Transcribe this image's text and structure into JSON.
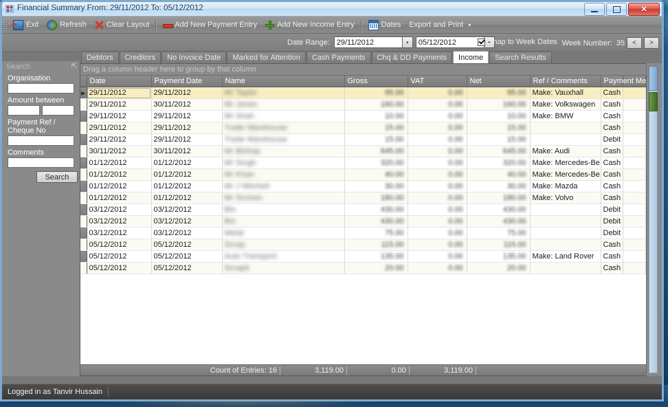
{
  "window": {
    "title": "Financial Summary From: 29/11/2012 To: 05/12/2012",
    "icon": "app-icon",
    "minimize": "—",
    "maximize": "▢",
    "close": "✕"
  },
  "toolbar": {
    "items": [
      {
        "label": "Exit",
        "icon": "exit-icon"
      },
      {
        "label": "Refresh",
        "icon": "refresh-icon"
      },
      {
        "label": "Clear Layout",
        "icon": "red-x-icon"
      },
      {
        "label": "Add New Payment Entry",
        "icon": "red-minus-icon"
      },
      {
        "label": "Add New Income Entry",
        "icon": "green-plus-icon"
      },
      {
        "label": "Dates",
        "icon": "calendar-icon"
      },
      {
        "label": "Export and Print",
        "icon": "none",
        "caret": "▾"
      }
    ]
  },
  "filterbar": {
    "date_range_label": "Date Range:",
    "date_from": "29/11/2012",
    "date_to": "05/12/2012",
    "dropdown_glyph": "▾",
    "snap_label": "Snap to Week Dates",
    "snap_checked": true,
    "week_label": "Week Number:",
    "week_number": "35",
    "prev_glyph": "<",
    "next_glyph": ">"
  },
  "sidebar": {
    "title": "Search",
    "pin_glyph": "⇱",
    "fields": [
      {
        "label": "Organisation",
        "value": "",
        "type": "text"
      },
      {
        "label": "Amount between",
        "value": "",
        "value2": "",
        "type": "range"
      },
      {
        "label": "Payment Ref / Cheque No",
        "value": "",
        "type": "text"
      },
      {
        "label": "Comments",
        "value": "",
        "type": "text"
      }
    ],
    "search_button": "Search"
  },
  "tabs": [
    {
      "label": "Debtors",
      "active": false
    },
    {
      "label": "Creditors",
      "active": false
    },
    {
      "label": "No Invoice Date",
      "active": false
    },
    {
      "label": "Marked for Attention",
      "active": false
    },
    {
      "label": "Cash Payments",
      "active": false
    },
    {
      "label": "Chq & DD Payments",
      "active": false
    },
    {
      "label": "Income",
      "active": true
    },
    {
      "label": "Search Results",
      "active": false
    }
  ],
  "grid": {
    "group_hint": "Drag a column header here to group by that column",
    "columns": [
      "Date",
      "Payment Date",
      "Name",
      "Gross",
      "VAT",
      "Net",
      "Ref / Comments",
      "Payment Method"
    ],
    "row_indicator_glyph": "▶",
    "rows": [
      {
        "date": "29/11/2012",
        "payment_date": "29/11/2012",
        "name": "Mr Taylor",
        "gross": "95.00",
        "vat": "0.00",
        "net": "95.00",
        "ref": "Make: Vauxhall",
        "method": "Cash",
        "selected": true
      },
      {
        "date": "29/11/2012",
        "payment_date": "30/11/2012",
        "name": "Mr Jones",
        "gross": "160.00",
        "vat": "0.00",
        "net": "160.00",
        "ref": "Make: Volkswagen",
        "method": "Cash",
        "selected": false
      },
      {
        "date": "29/11/2012",
        "payment_date": "29/11/2012",
        "name": "Mr Shah",
        "gross": "10.00",
        "vat": "0.00",
        "net": "10.00",
        "ref": "Make: BMW",
        "method": "Cash",
        "selected": false
      },
      {
        "date": "29/11/2012",
        "payment_date": "29/11/2012",
        "name": "Trade Warehouse",
        "gross": "15.00",
        "vat": "0.00",
        "net": "15.00",
        "ref": "",
        "method": "Cash",
        "selected": false
      },
      {
        "date": "29/11/2012",
        "payment_date": "29/11/2012",
        "name": "Trade Warehouse",
        "gross": "15.00",
        "vat": "0.00",
        "net": "15.00",
        "ref": "",
        "method": "Debit Card",
        "selected": false
      },
      {
        "date": "30/11/2012",
        "payment_date": "30/11/2012",
        "name": "Mr Bishop",
        "gross": "645.00",
        "vat": "0.00",
        "net": "645.00",
        "ref": "Make: Audi",
        "method": "Cash",
        "selected": false
      },
      {
        "date": "01/12/2012",
        "payment_date": "01/12/2012",
        "name": "Mr Singh",
        "gross": "320.00",
        "vat": "0.00",
        "net": "320.00",
        "ref": "Make: Mercedes-Be",
        "method": "Cash",
        "selected": false
      },
      {
        "date": "01/12/2012",
        "payment_date": "01/12/2012",
        "name": "Mr Khan",
        "gross": "40.00",
        "vat": "0.00",
        "net": "40.00",
        "ref": "Make: Mercedes-Be",
        "method": "Cash",
        "selected": false
      },
      {
        "date": "01/12/2012",
        "payment_date": "01/12/2012",
        "name": "Mr J Mitchell",
        "gross": "30.00",
        "vat": "0.00",
        "net": "30.00",
        "ref": "Make: Mazda",
        "method": "Cash",
        "selected": false
      },
      {
        "date": "01/12/2012",
        "payment_date": "01/12/2012",
        "name": "Mr Scriven",
        "gross": "180.00",
        "vat": "0.00",
        "net": "180.00",
        "ref": "Make: Volvo",
        "method": "Cash",
        "selected": false
      },
      {
        "date": "03/12/2012",
        "payment_date": "03/12/2012",
        "name": "Bin",
        "gross": "430.00",
        "vat": "0.00",
        "net": "430.00",
        "ref": "",
        "method": "Debit Card",
        "selected": false
      },
      {
        "date": "03/12/2012",
        "payment_date": "03/12/2012",
        "name": "Bin",
        "gross": "430.00",
        "vat": "0.00",
        "net": "430.00",
        "ref": "",
        "method": "Debit Card",
        "selected": false
      },
      {
        "date": "03/12/2012",
        "payment_date": "03/12/2012",
        "name": "Metal",
        "gross": "75.00",
        "vat": "0.00",
        "net": "75.00",
        "ref": "",
        "method": "Debit Card",
        "selected": false
      },
      {
        "date": "05/12/2012",
        "payment_date": "05/12/2012",
        "name": "Scrap",
        "gross": "115.00",
        "vat": "0.00",
        "net": "115.00",
        "ref": "",
        "method": "Cash",
        "selected": false
      },
      {
        "date": "05/12/2012",
        "payment_date": "05/12/2012",
        "name": "Auto Transport",
        "gross": "135.00",
        "vat": "0.00",
        "net": "135.00",
        "ref": "Make: Land Rover",
        "method": "Cash",
        "selected": false
      },
      {
        "date": "05/12/2012",
        "payment_date": "05/12/2012",
        "name": "Scrapit",
        "gross": "20.00",
        "vat": "0.00",
        "net": "20.00",
        "ref": "",
        "method": "Cash",
        "selected": false
      }
    ],
    "summary": {
      "count_label": "Count of Entries: 16",
      "gross_total": "3,119.00",
      "vat_total": "0.00",
      "net_total": "3,119.00"
    }
  },
  "statusbar": {
    "text": "Logged in as Tanvir Hussain"
  },
  "colors": {
    "selected_row": "#f7eec2",
    "alt_row": "#fbfbf3",
    "chrome": "#787878",
    "accent": "#2f6fb0"
  }
}
